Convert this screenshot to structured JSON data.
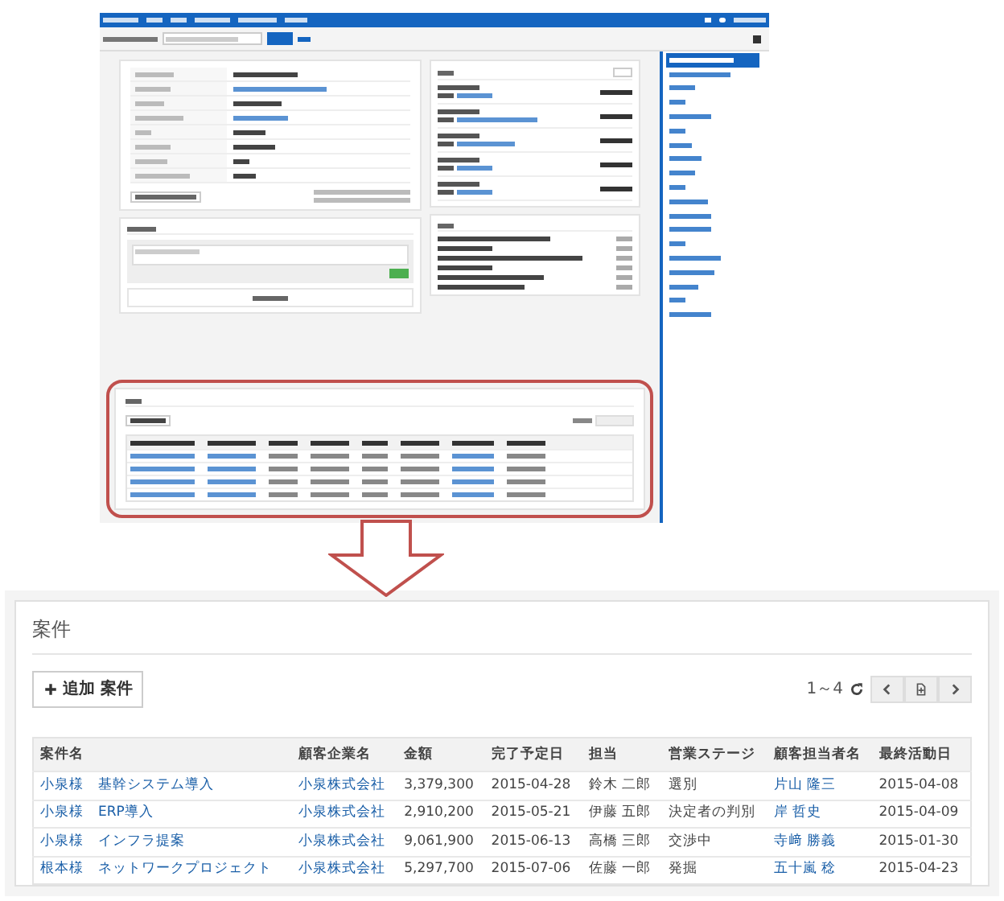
{
  "cases_panel": {
    "title": "案件",
    "add_button": "追加 案件",
    "count": "1～4",
    "columns": [
      {
        "label": "案件名",
        "link": true
      },
      {
        "label": "顧客企業名",
        "link": true
      },
      {
        "label": "金額",
        "link": false
      },
      {
        "label": "完了予定日",
        "link": false
      },
      {
        "label": "担当",
        "link": false
      },
      {
        "label": "営業ステージ",
        "link": false
      },
      {
        "label": "顧客担当者名",
        "link": true
      },
      {
        "label": "最終活動日",
        "link": false
      }
    ],
    "rows": [
      [
        "小泉様　基幹システム導入",
        "小泉株式会社",
        "3,379,300",
        "2015-04-28",
        "鈴木 二郎",
        "選別",
        "片山 隆三",
        "2015-04-08"
      ],
      [
        "小泉様　ERP導入",
        "小泉株式会社",
        "2,910,200",
        "2015-05-21",
        "伊藤 五郎",
        "決定者の判別",
        "岸 哲史",
        "2015-04-09"
      ],
      [
        "小泉様　インフラ提案",
        "小泉株式会社",
        "9,061,900",
        "2015-06-13",
        "高橋 三郎",
        "交渉中",
        "寺﨑 勝義",
        "2015-01-30"
      ],
      [
        "根本様　ネットワークプロジェクト",
        "小泉株式会社",
        "5,297,700",
        "2015-07-06",
        "佐藤 一郎",
        "発掘",
        "五十嵐 稔",
        "2015-04-23"
      ]
    ]
  }
}
